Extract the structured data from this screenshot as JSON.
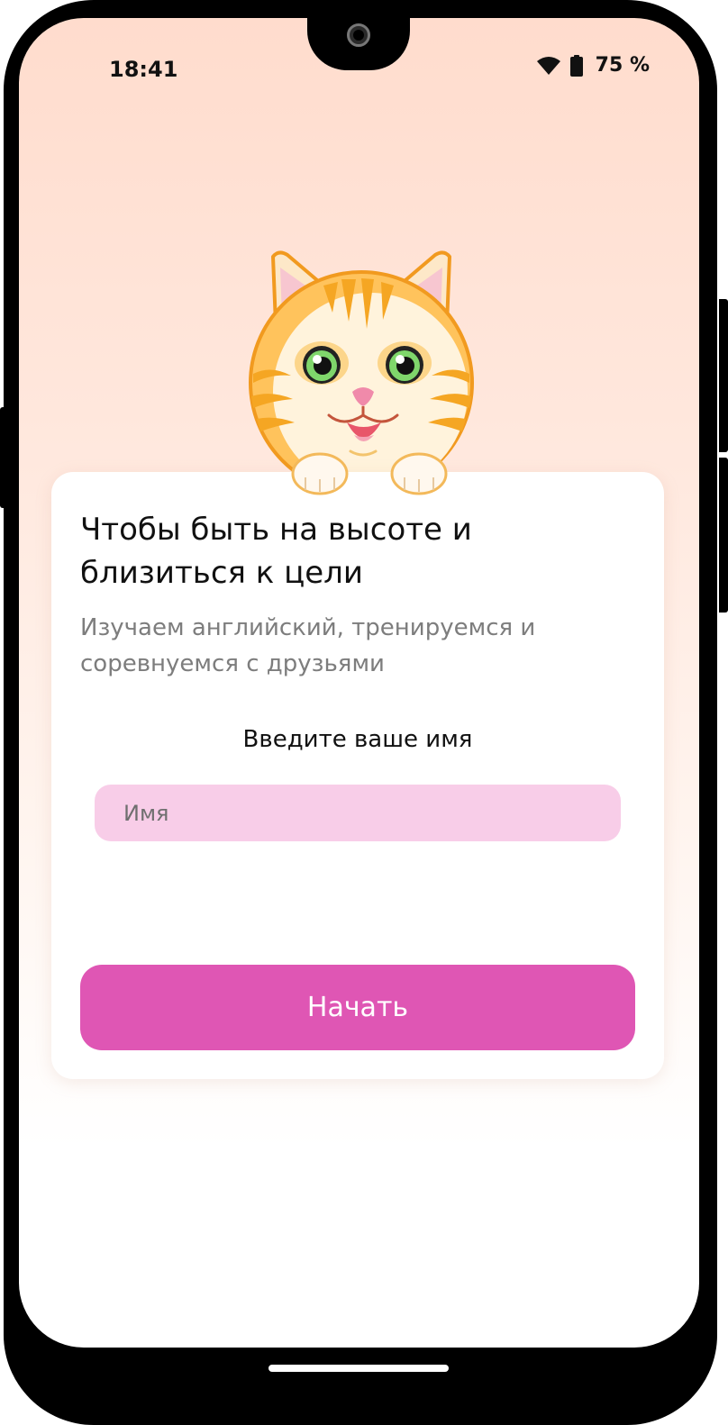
{
  "status_bar": {
    "time": "18:41",
    "battery": "75 %",
    "icons": [
      "wifi-icon",
      "battery-icon"
    ]
  },
  "illustration": {
    "icon": "cat-mascot-icon"
  },
  "card": {
    "title": "Чтобы быть на высоте и близиться к цели",
    "subtitle": "Изучаем английский, тренируемся и соревнуемся с друзьями",
    "name_label": "Введите ваше имя",
    "name_input": {
      "placeholder": "Имя",
      "value": ""
    },
    "start_button": "Начать"
  },
  "colors": {
    "accent": "#df56b4",
    "input_background": "#f8cde8",
    "background_top": "#ffdccd",
    "subtitle_text": "#7d7d7d"
  }
}
